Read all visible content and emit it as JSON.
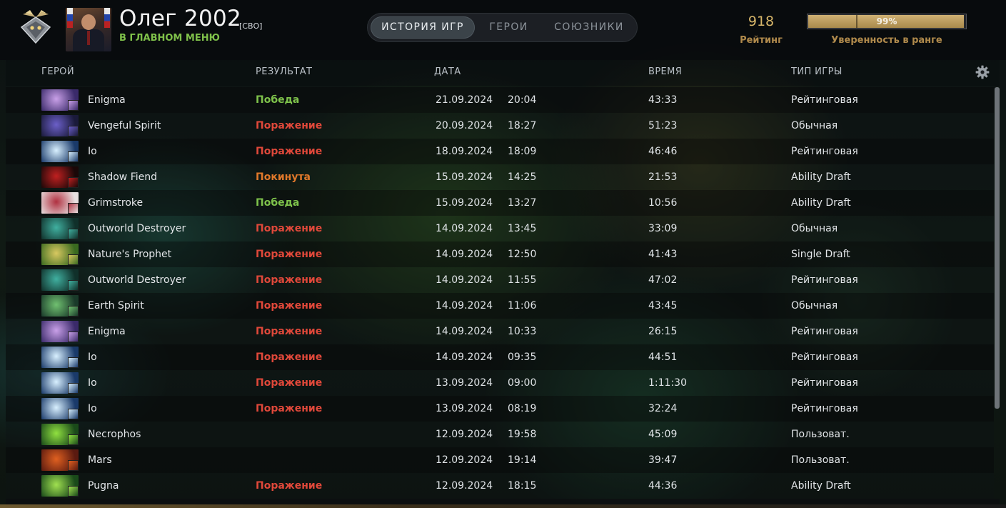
{
  "player": {
    "name": "Олег 2002",
    "tag": "[СВО]",
    "status": "В ГЛАВНОМ МЕНЮ"
  },
  "tabs": [
    {
      "label": "ИСТОРИЯ ИГР",
      "active": true
    },
    {
      "label": "ГЕРОИ",
      "active": false
    },
    {
      "label": "СОЮЗНИКИ",
      "active": false
    }
  ],
  "rating": {
    "value": "918",
    "label": "Рейтинг"
  },
  "confidence": {
    "value": "99%",
    "fraction": 0.99,
    "label": "Уверенность в ранге"
  },
  "columns": {
    "hero": "ГЕРОЙ",
    "result": "РЕЗУЛЬТАТ",
    "date": "ДАТА",
    "time": "ВРЕМЯ",
    "type": "ТИП ИГРЫ"
  },
  "colors": {
    "win": "#7ec24b",
    "loss": "#e0483a",
    "abandon": "#e0782a",
    "status": "#7fc14a",
    "gold": "#d8b76a"
  },
  "matches": [
    {
      "hero": "Enigma",
      "result": "Победа",
      "kind": "win",
      "date": "21.09.2024",
      "clock": "20:04",
      "duration": "43:33",
      "type": "Рейтинговая",
      "icon": "enigma-icon",
      "c1": "#c9a0e8",
      "c2": "#3a2a6a"
    },
    {
      "hero": "Vengeful Spirit",
      "result": "Поражение",
      "kind": "loss",
      "date": "20.09.2024",
      "clock": "18:27",
      "duration": "51:23",
      "type": "Обычная",
      "icon": "vengeful-spirit-icon",
      "c1": "#6b5fc8",
      "c2": "#1a1a3a"
    },
    {
      "hero": "Io",
      "result": "Поражение",
      "kind": "loss",
      "date": "18.09.2024",
      "clock": "18:09",
      "duration": "46:46",
      "type": "Рейтинговая",
      "icon": "io-icon",
      "c1": "#d8f0ff",
      "c2": "#1a3a6a"
    },
    {
      "hero": "Shadow Fiend",
      "result": "Покинута",
      "kind": "abandon",
      "date": "15.09.2024",
      "clock": "14:25",
      "duration": "21:53",
      "type": "Ability Draft",
      "icon": "shadow-fiend-icon",
      "c1": "#c02020",
      "c2": "#1a0808"
    },
    {
      "hero": "Grimstroke",
      "result": "Победа",
      "kind": "win",
      "date": "15.09.2024",
      "clock": "13:27",
      "duration": "10:56",
      "type": "Ability Draft",
      "icon": "grimstroke-icon",
      "c1": "#b03040",
      "c2": "#e8e0e0"
    },
    {
      "hero": "Outworld Destroyer",
      "result": "Поражение",
      "kind": "loss",
      "date": "14.09.2024",
      "clock": "13:45",
      "duration": "33:09",
      "type": "Обычная",
      "icon": "outworld-destroyer-icon",
      "c1": "#40b0a0",
      "c2": "#10302a"
    },
    {
      "hero": "Nature's Prophet",
      "result": "Поражение",
      "kind": "loss",
      "date": "14.09.2024",
      "clock": "12:50",
      "duration": "41:43",
      "type": "Single Draft",
      "icon": "natures-prophet-icon",
      "c1": "#d8c860",
      "c2": "#3a6a20"
    },
    {
      "hero": "Outworld Destroyer",
      "result": "Поражение",
      "kind": "loss",
      "date": "14.09.2024",
      "clock": "11:55",
      "duration": "47:02",
      "type": "Рейтинговая",
      "icon": "outworld-destroyer-icon",
      "c1": "#40b0a0",
      "c2": "#10302a"
    },
    {
      "hero": "Earth Spirit",
      "result": "Поражение",
      "kind": "loss",
      "date": "14.09.2024",
      "clock": "11:06",
      "duration": "43:45",
      "type": "Обычная",
      "icon": "earth-spirit-icon",
      "c1": "#70c070",
      "c2": "#1a3a2a"
    },
    {
      "hero": "Enigma",
      "result": "Поражение",
      "kind": "loss",
      "date": "14.09.2024",
      "clock": "10:33",
      "duration": "26:15",
      "type": "Рейтинговая",
      "icon": "enigma-icon",
      "c1": "#c9a0e8",
      "c2": "#3a2a6a"
    },
    {
      "hero": "Io",
      "result": "Поражение",
      "kind": "loss",
      "date": "14.09.2024",
      "clock": "09:35",
      "duration": "44:51",
      "type": "Рейтинговая",
      "icon": "io-icon",
      "c1": "#d8f0ff",
      "c2": "#1a3a6a"
    },
    {
      "hero": "Io",
      "result": "Поражение",
      "kind": "loss",
      "date": "13.09.2024",
      "clock": "09:00",
      "duration": "1:11:30",
      "type": "Рейтинговая",
      "icon": "io-icon",
      "c1": "#d8f0ff",
      "c2": "#1a3a6a"
    },
    {
      "hero": "Io",
      "result": "Поражение",
      "kind": "loss",
      "date": "13.09.2024",
      "clock": "08:19",
      "duration": "32:24",
      "type": "Рейтинговая",
      "icon": "io-icon",
      "c1": "#d8f0ff",
      "c2": "#1a3a6a"
    },
    {
      "hero": "Necrophos",
      "result": "",
      "kind": "none",
      "date": "12.09.2024",
      "clock": "19:58",
      "duration": "45:09",
      "type": "Пользоват.",
      "icon": "necrophos-icon",
      "c1": "#90e040",
      "c2": "#1a4a1a"
    },
    {
      "hero": "Mars",
      "result": "",
      "kind": "none",
      "date": "12.09.2024",
      "clock": "19:14",
      "duration": "39:47",
      "type": "Пользоват.",
      "icon": "mars-icon",
      "c1": "#e06020",
      "c2": "#5a1a10"
    },
    {
      "hero": "Pugna",
      "result": "Поражение",
      "kind": "loss",
      "date": "12.09.2024",
      "clock": "18:15",
      "duration": "44:36",
      "type": "Ability Draft",
      "icon": "pugna-icon",
      "c1": "#a0e050",
      "c2": "#1a4a1a"
    }
  ]
}
